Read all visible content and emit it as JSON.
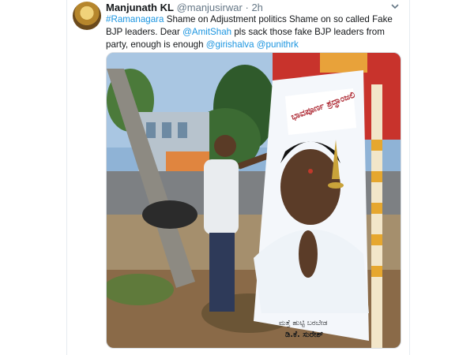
{
  "tweet": {
    "display_name": "Manjunath KL",
    "handle": "@manjusirwar",
    "separator": "·",
    "time": "2h",
    "segments": [
      {
        "text": "#Ramanagara",
        "link": true
      },
      {
        "text": " Shame on Adjustment politics Shame on so called Fake BJP leaders. Dear ",
        "link": false
      },
      {
        "text": "@AmitShah",
        "link": true
      },
      {
        "text": " pls sack those fake BJP leaders from party, enough is enough ",
        "link": false
      },
      {
        "text": "@girishalva",
        "link": true
      },
      {
        "text": " ",
        "link": false
      },
      {
        "text": "@punithrk",
        "link": true
      }
    ],
    "menu_icon": "chevron-down-icon"
  },
  "media": {
    "poster_heading": "ಭಾವಪೂರ್ಣ ಶ್ರದ್ಧಾಂಜಲಿ",
    "poster_footer_line1": "ಮತ್ತೆ ಹುಟ್ಟಿ ಬರಬೇಡ",
    "poster_footer_line2": "ಡಿ.ಕೆ. ಸುರೇಶ್"
  },
  "colors": {
    "link": "#1b95e0",
    "text": "#14171a",
    "muted": "#657786"
  }
}
